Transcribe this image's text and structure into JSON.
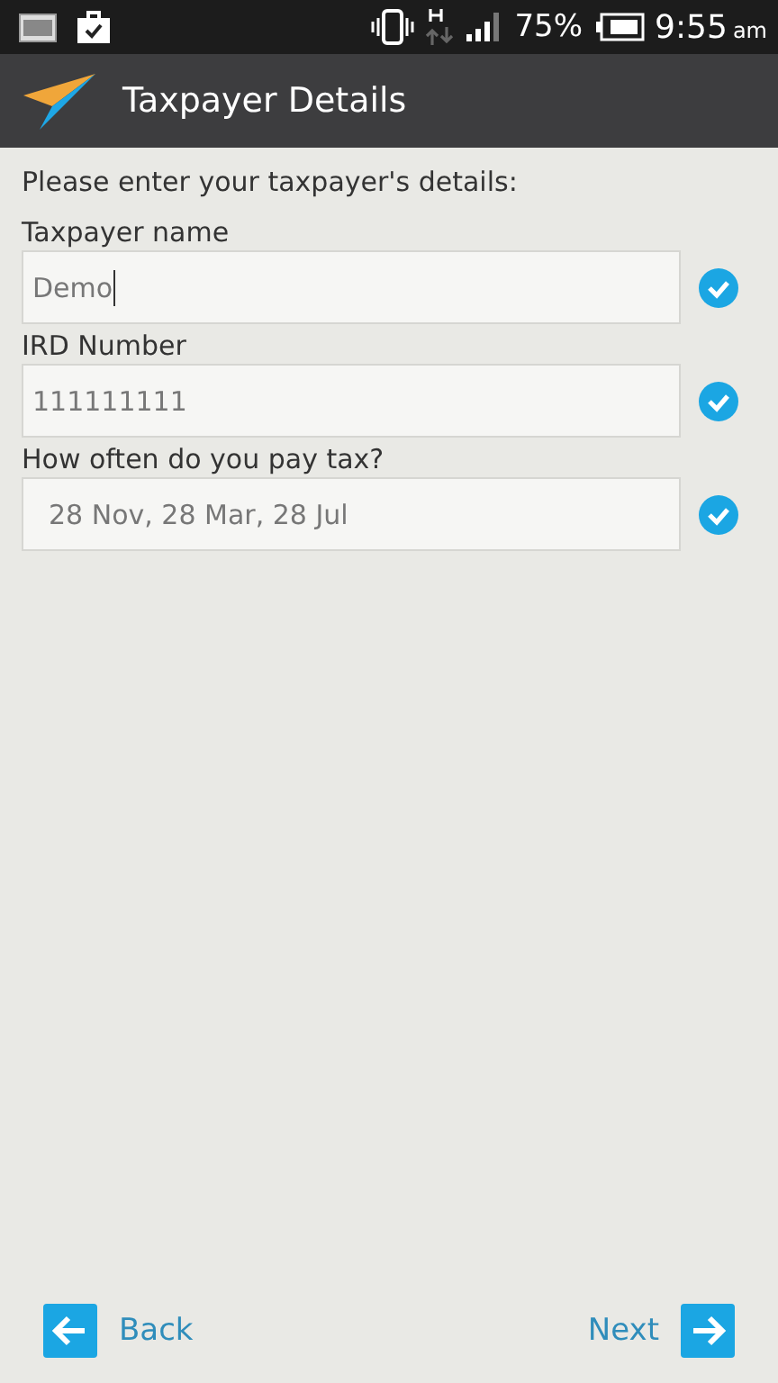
{
  "status_bar": {
    "battery": "75%",
    "time": "9:55",
    "time_suffix": "am"
  },
  "app_bar": {
    "title": "Taxpayer Details"
  },
  "intro": "Please enter your taxpayer's details:",
  "fields": [
    {
      "label": "Taxpayer name",
      "value": "Demo",
      "kind": "text",
      "focused": true,
      "valid": true
    },
    {
      "label": "IRD Number",
      "value": "111111111",
      "kind": "text",
      "focused": false,
      "valid": true
    },
    {
      "label": "How often do you pay tax?",
      "value": "28 Nov, 28 Mar, 28 Jul",
      "kind": "select",
      "valid": true
    }
  ],
  "footer": {
    "back": "Back",
    "next": "Next"
  }
}
